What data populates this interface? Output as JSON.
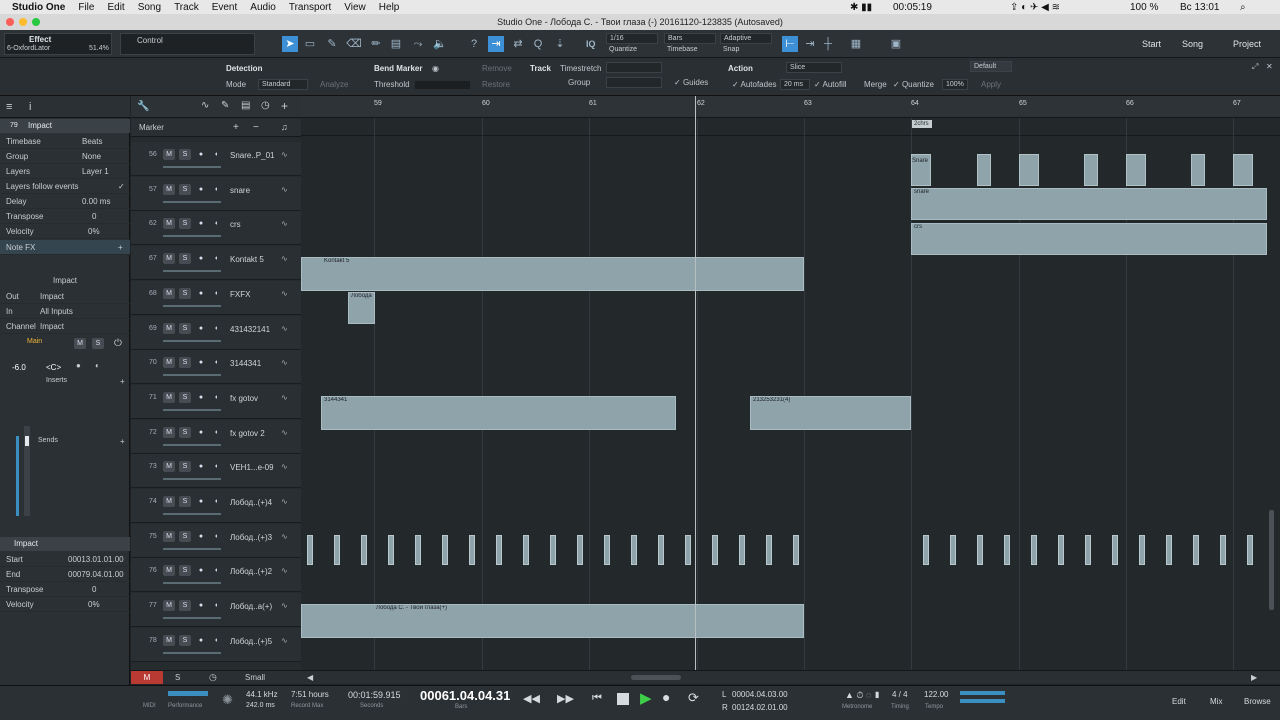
{
  "menubar": {
    "app": "Studio One",
    "items": [
      "File",
      "Edit",
      "Song",
      "Track",
      "Event",
      "Audio",
      "Transport",
      "View",
      "Help"
    ],
    "timer": "00:05:19",
    "battery": "100 %",
    "clock": "Вс 13:01"
  },
  "title": "Studio One - Лобода С. - Твои глаза (-) 20161120-123835 (Autosaved)",
  "toolbar": {
    "effect_label": "Effect",
    "effect_name": "6-OxfordLator",
    "effect_pct": "51.4%",
    "control_label": "Control",
    "quantize_value": "1/16",
    "quantize_label": "Quantize",
    "timebase_value": "Bars",
    "timebase_label": "Timebase",
    "snap_value": "Adaptive",
    "snap_label": "Snap",
    "iq": "IQ",
    "start": "Start",
    "song": "Song",
    "project": "Project"
  },
  "inspector_bar": {
    "detection": "Detection",
    "mode_label": "Mode",
    "mode_value": "Standard",
    "analyze": "Analyze",
    "bend_marker": "Bend Marker",
    "threshold": "Threshold",
    "remove": "Remove",
    "restore": "Restore",
    "track": "Track",
    "timestretch": "Timestretch",
    "group": "Group",
    "guides": "Guides",
    "action": "Action",
    "slice": "Slice",
    "autofades": "Autofades",
    "autofades_value": "20 ms",
    "autofill": "Autofill",
    "merge": "Merge",
    "quantize": "Quantize",
    "quantize_value": "100%",
    "default": "Default",
    "apply": "Apply"
  },
  "left": {
    "track_num": "79",
    "track_name": "Impact",
    "rows": [
      {
        "k": "Timebase",
        "v": "Beats"
      },
      {
        "k": "Group",
        "v": "None"
      },
      {
        "k": "Layers",
        "v": "Layer 1"
      },
      {
        "k": "Layers follow events",
        "v": "✓"
      },
      {
        "k": "Delay",
        "v": "0.00 ms"
      },
      {
        "k": "Transpose",
        "v": "0"
      },
      {
        "k": "Velocity",
        "v": "0%"
      }
    ],
    "note_fx": "Note FX",
    "channel_name": "Impact",
    "io": [
      {
        "k": "Out",
        "v": "Impact"
      },
      {
        "k": "In",
        "v": "All Inputs"
      },
      {
        "k": "Channel",
        "v": "Impact"
      }
    ],
    "main": "Main",
    "volume": "-6.0",
    "pan": "<C>",
    "inserts": "Inserts",
    "sends": "Sends",
    "event_title": "Impact",
    "event_rows": [
      {
        "k": "Start",
        "v": "00013.01.01.00"
      },
      {
        "k": "End",
        "v": "00079.04.01.00"
      },
      {
        "k": "Transpose",
        "v": "0"
      },
      {
        "k": "Velocity",
        "v": "0%"
      }
    ]
  },
  "tracklist": {
    "marker": "Marker",
    "tracks": [
      {
        "n": "56",
        "name": "Snare..P_01"
      },
      {
        "n": "57",
        "name": "snare"
      },
      {
        "n": "62",
        "name": "crs"
      },
      {
        "n": "67",
        "name": "Kontakt 5"
      },
      {
        "n": "68",
        "name": "FXFX"
      },
      {
        "n": "69",
        "name": "431432141"
      },
      {
        "n": "70",
        "name": "3144341"
      },
      {
        "n": "71",
        "name": "fx gotov"
      },
      {
        "n": "72",
        "name": "fx gotov 2"
      },
      {
        "n": "73",
        "name": "VEH1...e-09"
      },
      {
        "n": "74",
        "name": "Лобод..(+)4"
      },
      {
        "n": "75",
        "name": "Лобод..(+)3"
      },
      {
        "n": "76",
        "name": "Лобод..(+)2"
      },
      {
        "n": "77",
        "name": "Лобод..а(+)"
      },
      {
        "n": "78",
        "name": "Лобод..(+)5"
      }
    ]
  },
  "ruler": {
    "bars": [
      "59",
      "60",
      "61",
      "62",
      "63",
      "64",
      "65",
      "66",
      "67"
    ],
    "marker": "2chrs"
  },
  "clips": {
    "kontakt": "Kontakt 5",
    "fxfx": "Лобода",
    "c71a": "3144341",
    "c71b": "213253231(4)",
    "c77": "Лобода С. - Твои глаза(+)",
    "snare": "Snare",
    "snare2": "snare",
    "crs": "crs"
  },
  "bottom": {
    "m": "M",
    "s": "S",
    "small": "Small"
  },
  "transport": {
    "midi": "MIDI",
    "performance": "Performance",
    "rate": "44.1 kHz",
    "rate2": "242.0 ms",
    "hours": "7:51 hours",
    "hours_label": "Record Max",
    "seconds": "00:01:59.915",
    "seconds_label": "Seconds",
    "bars": "00061.04.04.31",
    "bars_label": "Bars",
    "l": "00004.04.03.00",
    "r": "00124.02.01.00",
    "metronome": "Metronome",
    "sig": "4 / 4",
    "timing": "Timing",
    "tempo": "122.00",
    "tempo_label": "Tempo",
    "edit": "Edit",
    "mix": "Mix",
    "browse": "Browse"
  },
  "colors": {
    "accent": "#3d8fd6",
    "clip": "#8fa3ab",
    "play": "#3ecf4a",
    "record_m": "#c0392b"
  }
}
